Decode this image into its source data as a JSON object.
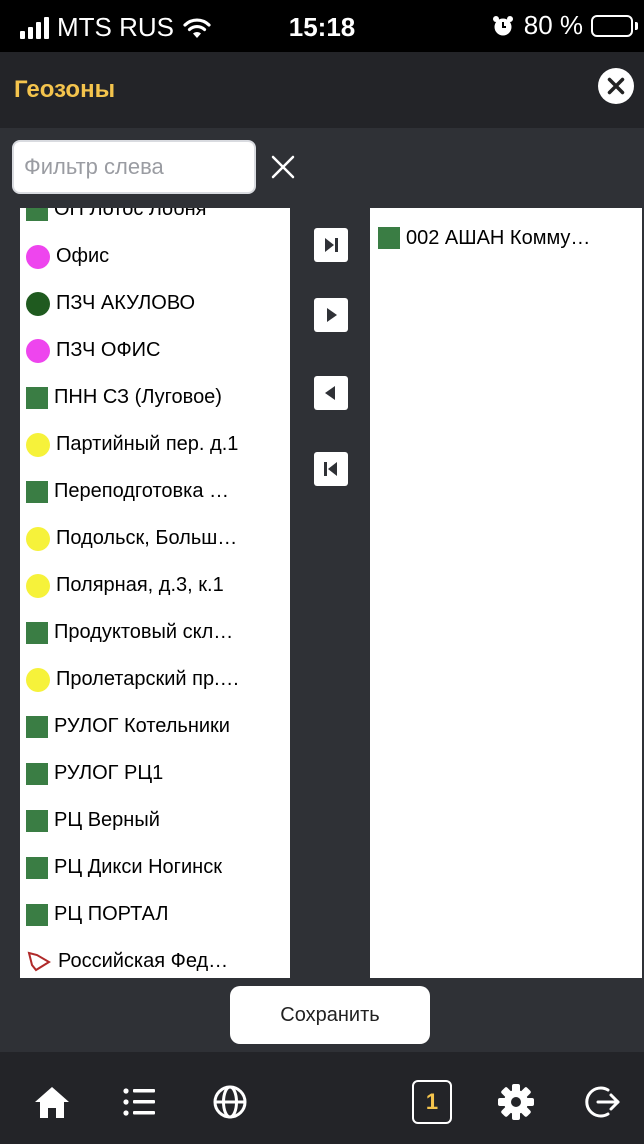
{
  "status_bar": {
    "carrier": "MTS RUS",
    "time": "15:18",
    "battery": "80 %",
    "battery_level": 0.8
  },
  "header": {
    "title": "Геозоны"
  },
  "filter": {
    "placeholder": "Фильтр слева",
    "value": ""
  },
  "left_list": {
    "items": [
      {
        "label": "ОП Лотос Лобня",
        "marker": "square",
        "color": "#3a7d44"
      },
      {
        "label": "Офис",
        "marker": "circle",
        "color": "#ee45ee"
      },
      {
        "label": "ПЗЧ АКУЛОВО",
        "marker": "circle",
        "color": "#1f5a1f"
      },
      {
        "label": "ПЗЧ ОФИС",
        "marker": "circle",
        "color": "#ee45ee"
      },
      {
        "label": "ПНН СЗ (Луговое)",
        "marker": "square",
        "color": "#3a7d44"
      },
      {
        "label": "Партийный пер. д.1",
        "marker": "circle",
        "color": "#f6f23a"
      },
      {
        "label": "Переподготовка …",
        "marker": "square",
        "color": "#3a7d44"
      },
      {
        "label": "Подольск, Больш…",
        "marker": "circle",
        "color": "#f6f23a"
      },
      {
        "label": "Полярная, д.3, к.1",
        "marker": "circle",
        "color": "#f6f23a"
      },
      {
        "label": "Продуктовый скл…",
        "marker": "square",
        "color": "#3a7d44"
      },
      {
        "label": "Пролетарский пр.…",
        "marker": "circle",
        "color": "#f6f23a"
      },
      {
        "label": "РУЛОГ Котельники",
        "marker": "square",
        "color": "#3a7d44"
      },
      {
        "label": "РУЛОГ РЦ1",
        "marker": "square",
        "color": "#3a7d44"
      },
      {
        "label": "РЦ Верный",
        "marker": "square",
        "color": "#3a7d44"
      },
      {
        "label": "РЦ Дикси Ногинск",
        "marker": "square",
        "color": "#3a7d44"
      },
      {
        "label": "РЦ ПОРТАЛ",
        "marker": "square",
        "color": "#3a7d44"
      },
      {
        "label": "Российская Фед…",
        "marker": "polygon",
        "color": "#b02a2a"
      }
    ]
  },
  "right_list": {
    "items": [
      {
        "label": "002 АШАН Комму…",
        "marker": "square",
        "color": "#3a7d44"
      }
    ]
  },
  "transfer_buttons": [
    {
      "name": "move-all-right-button",
      "icon": "last-icon"
    },
    {
      "name": "move-right-button",
      "icon": "play-right-icon"
    },
    {
      "name": "move-left-button",
      "icon": "play-left-icon"
    },
    {
      "name": "move-all-left-button",
      "icon": "first-icon"
    }
  ],
  "save_label": "Сохранить",
  "bottom_nav": {
    "badge": "1",
    "icons": [
      "home-icon",
      "list-icon",
      "globe-icon",
      "counter-badge",
      "gear-icon",
      "logout-icon"
    ]
  },
  "colors": {
    "accent": "#f4c44d",
    "header_bg": "#232428",
    "body_bg": "#2f3136"
  }
}
